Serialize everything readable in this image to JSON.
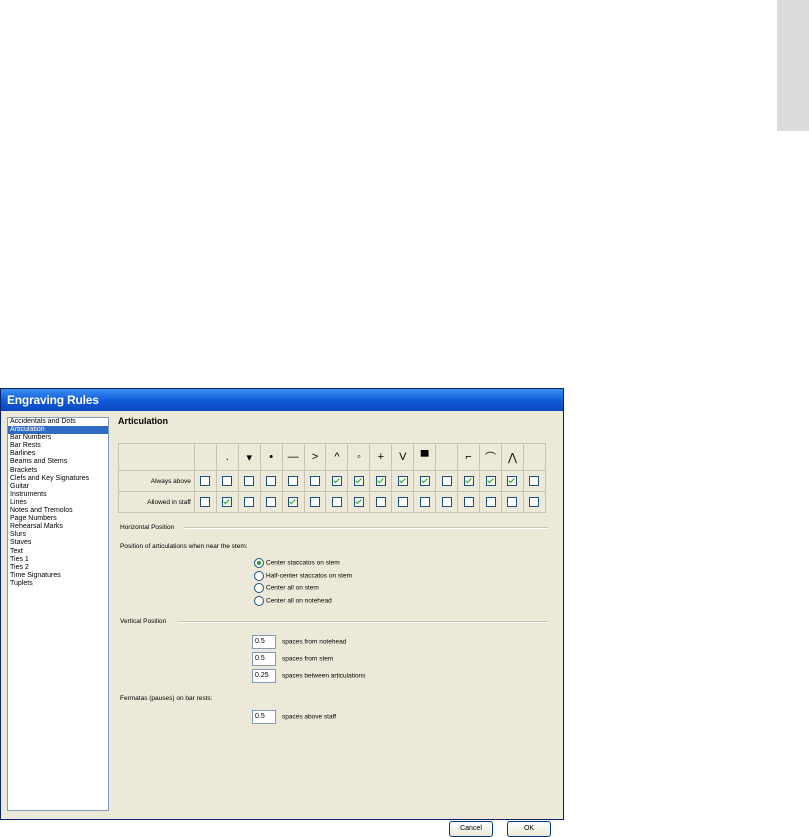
{
  "dialog": {
    "title": "Engraving Rules",
    "sidebar": {
      "items": [
        "Accidentals and Dots",
        "Articulation",
        "Bar Numbers",
        "Bar Rests",
        "Barlines",
        "Beams and Stems",
        "Brackets",
        "Clefs and Key Signatures",
        "Guitar",
        "Instruments",
        "Lines",
        "Notes and Tremolos",
        "Page Numbers",
        "Rehearsal Marks",
        "Slurs",
        "Staves",
        "Text",
        "Ties 1",
        "Ties 2",
        "Time Signatures",
        "Tuplets"
      ],
      "selected": "Articulation"
    },
    "section_title": "Articulation",
    "articulation_table": {
      "symbols": [
        "",
        ".",
        "▾",
        "•",
        "—",
        ">",
        "^",
        "◦",
        "+",
        "V",
        "▀",
        "",
        "⌐",
        "⌒",
        "⋀",
        ""
      ],
      "rows": [
        {
          "label": "Always above",
          "checked": [
            false,
            false,
            false,
            false,
            false,
            false,
            true,
            true,
            true,
            true,
            true,
            false,
            true,
            true,
            true,
            false
          ]
        },
        {
          "label": "Allowed in staff",
          "checked": [
            false,
            true,
            false,
            false,
            true,
            false,
            false,
            true,
            false,
            false,
            false,
            false,
            false,
            false,
            false,
            false
          ]
        }
      ]
    },
    "horizontal_position": {
      "heading": "Horizontal Position",
      "prompt": "Position of articulations when near the stem:",
      "options": [
        "Center staccatos on stem",
        "Half-center staccatos on stem",
        "Center all on stem",
        "Center all on notehead"
      ],
      "selected_index": 0
    },
    "vertical_position": {
      "heading": "Vertical Position",
      "fields": [
        {
          "value": "0.5",
          "label": "spaces from notehead"
        },
        {
          "value": "0.5",
          "label": "spaces from stem"
        },
        {
          "value": "0.25",
          "label": "spaces between articulations"
        }
      ]
    },
    "fermatas": {
      "heading": "Fermatas (pauses) on bar rests:",
      "value": "0.5",
      "label": "spaces above staff"
    },
    "buttons": {
      "cancel": "Cancel",
      "ok": "OK"
    }
  }
}
